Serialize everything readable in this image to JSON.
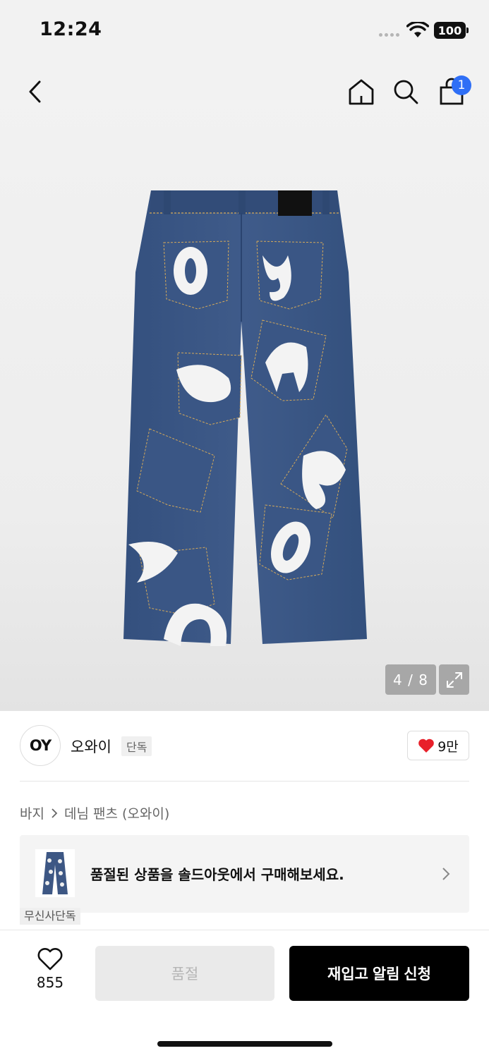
{
  "status_bar": {
    "time": "12:24",
    "battery": "100"
  },
  "header": {
    "icons": [
      "chevron-left-icon",
      "home-icon",
      "search-icon",
      "shopping-bag-icon"
    ],
    "cart_count": "1"
  },
  "gallery": {
    "counter": "4 / 8"
  },
  "brand": {
    "logo_text": "OY",
    "name": "오와이",
    "tag": "단독",
    "likes": "9만"
  },
  "breadcrumb": {
    "category": "바지",
    "subcategory": "데님 팬츠 (오와이)"
  },
  "soldout_banner": {
    "text": "품절된 상품을 솔드아웃에서 구매해보세요."
  },
  "exclusive_tag": "무신사단독",
  "bottom_bar": {
    "wish_count": "855",
    "soldout_label": "품절",
    "restock_label": "재입고 알림 신청"
  },
  "colors": {
    "accent_blue": "#2f6ff6",
    "heart_red": "#e8202a",
    "denim": "#3d5784"
  }
}
